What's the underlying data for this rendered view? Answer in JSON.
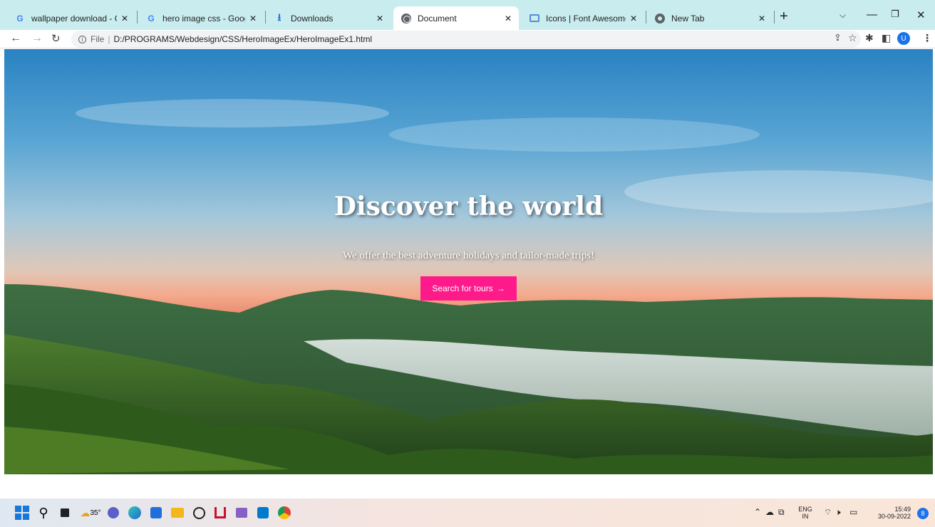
{
  "tabs": [
    {
      "title": "wallpaper download - Goo",
      "favicon": "google-icon",
      "active": false
    },
    {
      "title": "hero image css - Google Se",
      "favicon": "google-icon",
      "active": false
    },
    {
      "title": "Downloads",
      "favicon": "download-icon",
      "active": false
    },
    {
      "title": "Document",
      "favicon": "globe-icon",
      "active": true
    },
    {
      "title": "Icons | Font Awesome",
      "favicon": "flag-icon",
      "active": false
    },
    {
      "title": "New Tab",
      "favicon": "chrome-icon",
      "active": false
    }
  ],
  "address_bar": {
    "scheme": "File",
    "url": "D:/PROGRAMS/Webdesign/CSS/HeroImageEx/HeroImageEx1.html"
  },
  "profile": {
    "initial": "U"
  },
  "hero": {
    "title": "Discover the world",
    "subtitle": "We offer the best adventure holidays and tailor-made trips!",
    "cta_label": "Search for tours",
    "cta_color": "#ff1a8c"
  },
  "taskbar": {
    "weather_temp": "35°",
    "language": "ENG",
    "region": "IN",
    "time": "15:49",
    "date": "30-09-2022",
    "notifications": "8"
  }
}
